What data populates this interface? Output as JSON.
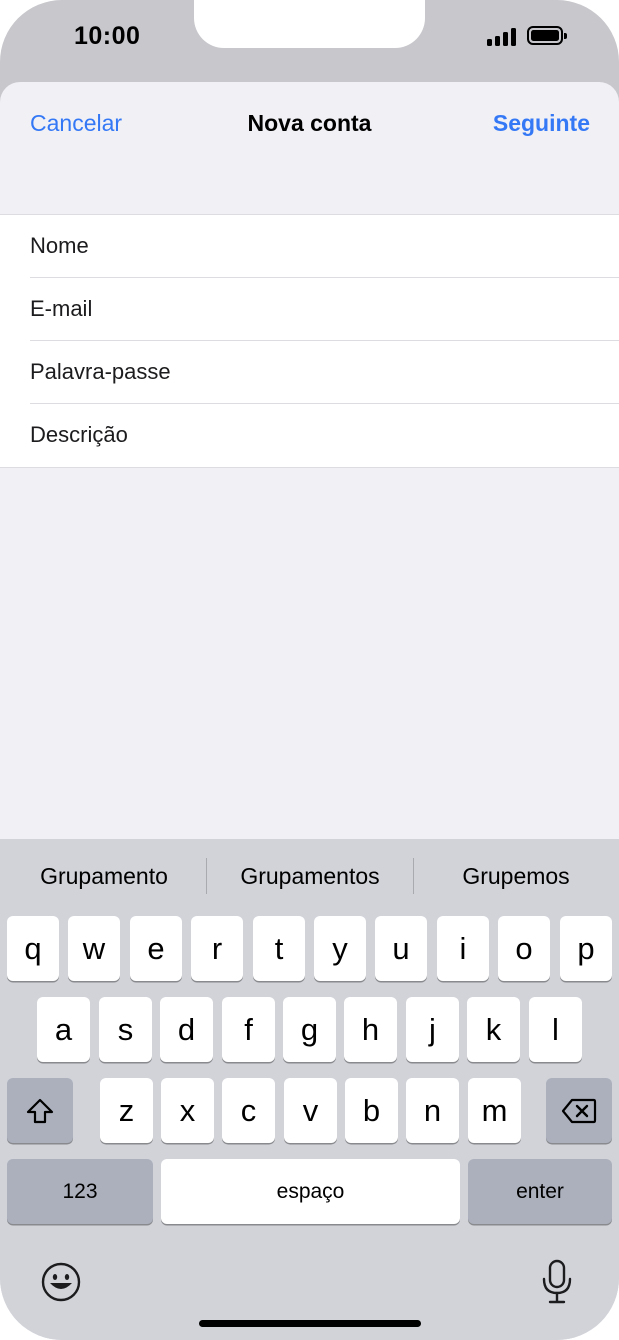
{
  "status_bar": {
    "time": "10:00"
  },
  "nav": {
    "cancel": "Cancelar",
    "title": "Nova conta",
    "next": "Seguinte"
  },
  "form": {
    "name_placeholder": "Nome",
    "email_placeholder": "E-mail",
    "password_placeholder": "Palavra-passe",
    "description_placeholder": "Descrição"
  },
  "keyboard": {
    "suggestions": [
      "Grupamento",
      "Grupamentos",
      "Grupemos"
    ],
    "row1": [
      "q",
      "w",
      "e",
      "r",
      "t",
      "y",
      "u",
      "i",
      "o",
      "p"
    ],
    "row2": [
      "a",
      "s",
      "d",
      "f",
      "g",
      "h",
      "j",
      "k",
      "l"
    ],
    "row3": [
      "z",
      "x",
      "c",
      "v",
      "b",
      "n",
      "m"
    ],
    "numbers_label": "123",
    "space_label": "espaço",
    "return_label": "enter",
    "icons": [
      "shift-icon",
      "delete-icon",
      "emoji-icon",
      "microphone-icon"
    ]
  },
  "colors": {
    "accent": "#3478f6",
    "sheet_bg": "#f0f0f5",
    "keyboard_bg": "#d1d3d9"
  }
}
